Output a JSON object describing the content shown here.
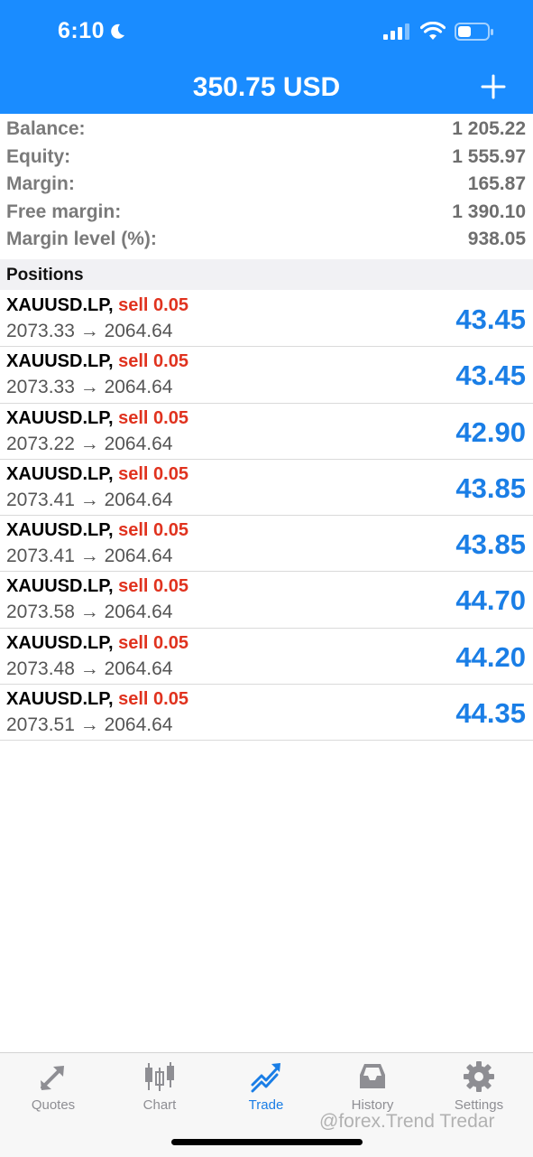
{
  "status_bar": {
    "time": "6:10"
  },
  "header": {
    "title": "350.75 USD"
  },
  "account": [
    {
      "label": "Balance:",
      "value": "1 205.22"
    },
    {
      "label": "Equity:",
      "value": "1 555.97"
    },
    {
      "label": "Margin:",
      "value": "165.87"
    },
    {
      "label": "Free margin:",
      "value": "1 390.10"
    },
    {
      "label": "Margin level (%):",
      "value": "938.05"
    }
  ],
  "positions_header": "Positions",
  "positions": [
    {
      "symbol": "XAUUSD.LP,",
      "side": "sell 0.05",
      "prices": "2073.33 → 2064.64",
      "profit": "43.45"
    },
    {
      "symbol": "XAUUSD.LP,",
      "side": "sell 0.05",
      "prices": "2073.33 → 2064.64",
      "profit": "43.45"
    },
    {
      "symbol": "XAUUSD.LP,",
      "side": "sell 0.05",
      "prices": "2073.22 → 2064.64",
      "profit": "42.90"
    },
    {
      "symbol": "XAUUSD.LP,",
      "side": "sell 0.05",
      "prices": "2073.41 → 2064.64",
      "profit": "43.85"
    },
    {
      "symbol": "XAUUSD.LP,",
      "side": "sell 0.05",
      "prices": "2073.41 → 2064.64",
      "profit": "43.85"
    },
    {
      "symbol": "XAUUSD.LP,",
      "side": "sell 0.05",
      "prices": "2073.58 → 2064.64",
      "profit": "44.70"
    },
    {
      "symbol": "XAUUSD.LP,",
      "side": "sell 0.05",
      "prices": "2073.48 → 2064.64",
      "profit": "44.20"
    },
    {
      "symbol": "XAUUSD.LP,",
      "side": "sell 0.05",
      "prices": "2073.51 → 2064.64",
      "profit": "44.35"
    }
  ],
  "tabs": [
    {
      "label": "Quotes",
      "icon": "quotes-icon"
    },
    {
      "label": "Chart",
      "icon": "chart-icon"
    },
    {
      "label": "Trade",
      "icon": "trade-icon",
      "active": true
    },
    {
      "label": "History",
      "icon": "history-icon"
    },
    {
      "label": "Settings",
      "icon": "gear-icon"
    }
  ],
  "watermark": "@forex.Trend Tredar",
  "colors": {
    "header": "#1a8cff",
    "profit": "#1a7ee6",
    "sell": "#e0321e",
    "active_tab": "#1a7ee6"
  }
}
